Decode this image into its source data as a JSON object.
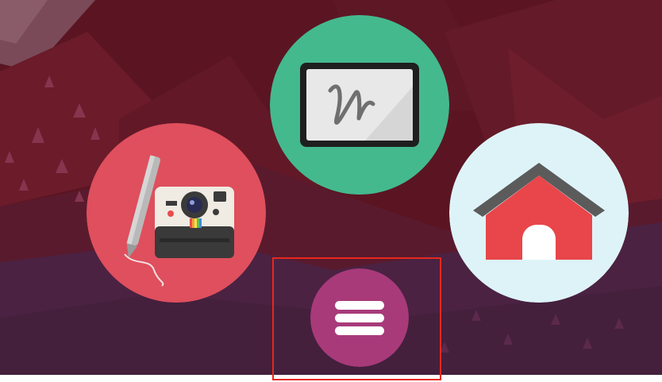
{
  "screen": {
    "description_free": true
  },
  "launcher": {
    "items": [
      {
        "id": "photo",
        "icon": "camera-pen-icon"
      },
      {
        "id": "draw",
        "icon": "drawing-tablet-icon"
      },
      {
        "id": "home",
        "icon": "house-icon"
      }
    ],
    "menu_button": {
      "icon": "hamburger-menu-icon"
    }
  },
  "colors": {
    "wallpaper_dark": "#5a1521",
    "wallpaper_mid": "#6e1c2b",
    "wallpaper_purple": "#4a2140",
    "photo_circle": "#df4f5d",
    "draw_circle": "#44b98e",
    "home_circle": "#def3f8",
    "menu_circle": "#a83a7a",
    "highlight": "#e8281b"
  }
}
